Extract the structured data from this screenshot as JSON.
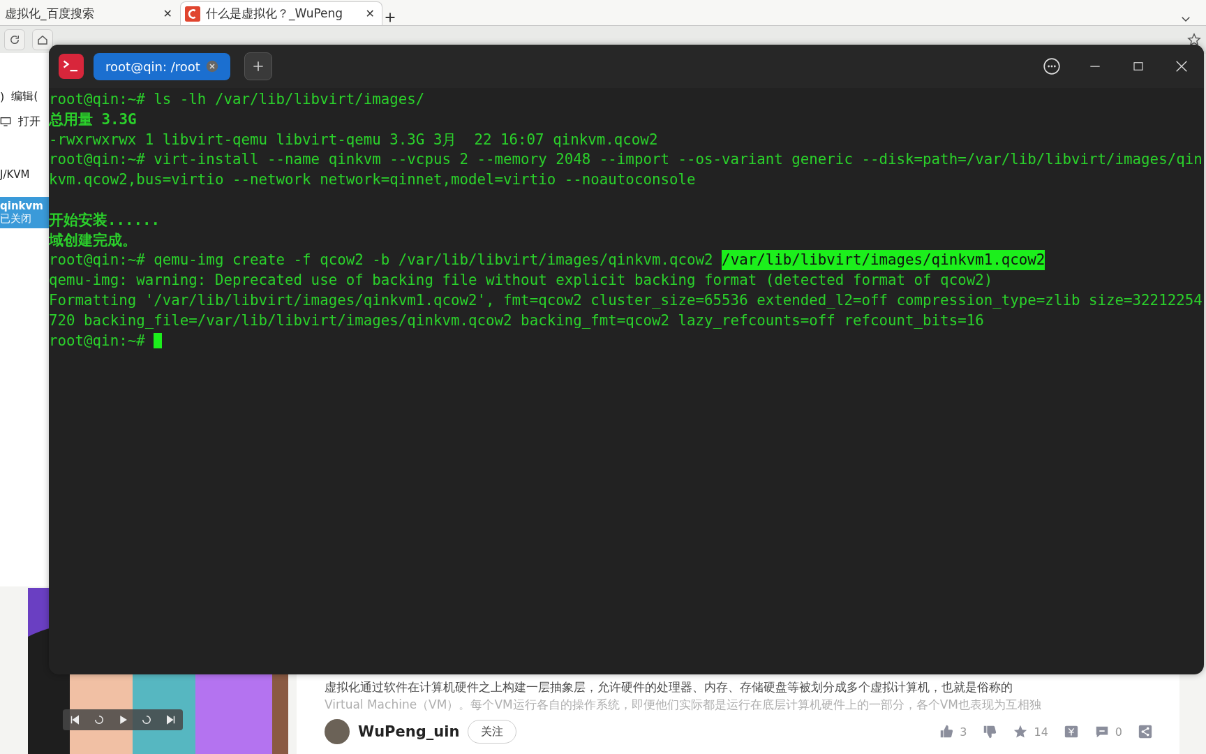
{
  "browser": {
    "tabs": [
      {
        "title": "虚拟化_百度搜索",
        "close": "✕",
        "selected": false
      },
      {
        "title": "什么是虚拟化？_WuPeng",
        "close": "✕",
        "selected": true
      }
    ]
  },
  "side_window": {
    "menu": [
      ")",
      "编辑("
    ],
    "open_label": "打开",
    "group": "J/KVM",
    "vm": {
      "name": "qinkvm",
      "status": "已关闭",
      "selected": true
    }
  },
  "article": {
    "lines": [
      "虚拟化通过软件在计算机硬件之上构建一层抽象层，允许硬件的处理器、内存、存储硬盘等被划分成多个虚拟计算机，也就是俗称的",
      "Virtual Machine（VM）。每个VM运行各自的操作系统，即便他们实际都是运行在底层计算机硬件上的一部分，各个VM也表现为互相独"
    ],
    "author": "WuPeng_uin",
    "follow": "关注",
    "likes": "3",
    "favorites": "14",
    "comments": "0"
  },
  "terminal": {
    "tab_title": "root@qin: /root",
    "lines": [
      {
        "kind": "text",
        "bold": false,
        "cursor": false,
        "parts": [
          {
            "text": "root@qin:~# ls -lh /var/lib/libvirt/images/",
            "selected": false
          }
        ]
      },
      {
        "kind": "text",
        "bold": true,
        "cursor": false,
        "parts": [
          {
            "text": "总用量 3.3G",
            "selected": false
          }
        ]
      },
      {
        "kind": "text",
        "bold": false,
        "cursor": false,
        "parts": [
          {
            "text": "-rwxrwxrwx 1 libvirt-qemu libvirt-qemu 3.3G 3月  22 16:07 qinkvm.qcow2",
            "selected": false
          }
        ]
      },
      {
        "kind": "text",
        "bold": false,
        "cursor": false,
        "parts": [
          {
            "text": "root@qin:~# virt-install --name qinkvm --vcpus 2 --memory 2048 --import --os-variant generic --disk=path=/var/lib/libvirt/images/qin",
            "selected": false
          }
        ]
      },
      {
        "kind": "text",
        "bold": false,
        "cursor": false,
        "parts": [
          {
            "text": "kvm.qcow2,bus=virtio --network network=qinnet,model=virtio --noautoconsole",
            "selected": false
          }
        ]
      },
      {
        "kind": "blank"
      },
      {
        "kind": "text",
        "bold": true,
        "cursor": false,
        "parts": [
          {
            "text": "开始安装......",
            "selected": false
          }
        ]
      },
      {
        "kind": "text",
        "bold": true,
        "cursor": false,
        "parts": [
          {
            "text": "域创建完成。",
            "selected": false
          }
        ]
      },
      {
        "kind": "text",
        "bold": false,
        "cursor": false,
        "parts": [
          {
            "text": "root@qin:~# qemu-img create -f qcow2 -b /var/lib/libvirt/images/qinkvm.qcow2 ",
            "selected": false
          },
          {
            "text": "/var/lib/libvirt/images/qinkvm1.qcow2",
            "selected": true
          }
        ]
      },
      {
        "kind": "text",
        "bold": false,
        "cursor": false,
        "parts": [
          {
            "text": "qemu-img: warning: Deprecated use of backing file without explicit backing format (detected format of qcow2)",
            "selected": false
          }
        ]
      },
      {
        "kind": "text",
        "bold": false,
        "cursor": false,
        "parts": [
          {
            "text": "Formatting '/var/lib/libvirt/images/qinkvm1.qcow2', fmt=qcow2 cluster_size=65536 extended_l2=off compression_type=zlib size=32212254",
            "selected": false
          }
        ]
      },
      {
        "kind": "text",
        "bold": false,
        "cursor": false,
        "parts": [
          {
            "text": "720 backing_file=/var/lib/libvirt/images/qinkvm.qcow2 backing_fmt=qcow2 lazy_refcounts=off refcount_bits=16",
            "selected": false
          }
        ]
      },
      {
        "kind": "text",
        "bold": false,
        "cursor": true,
        "parts": [
          {
            "text": "root@qin:~# ",
            "selected": false
          }
        ]
      }
    ]
  }
}
